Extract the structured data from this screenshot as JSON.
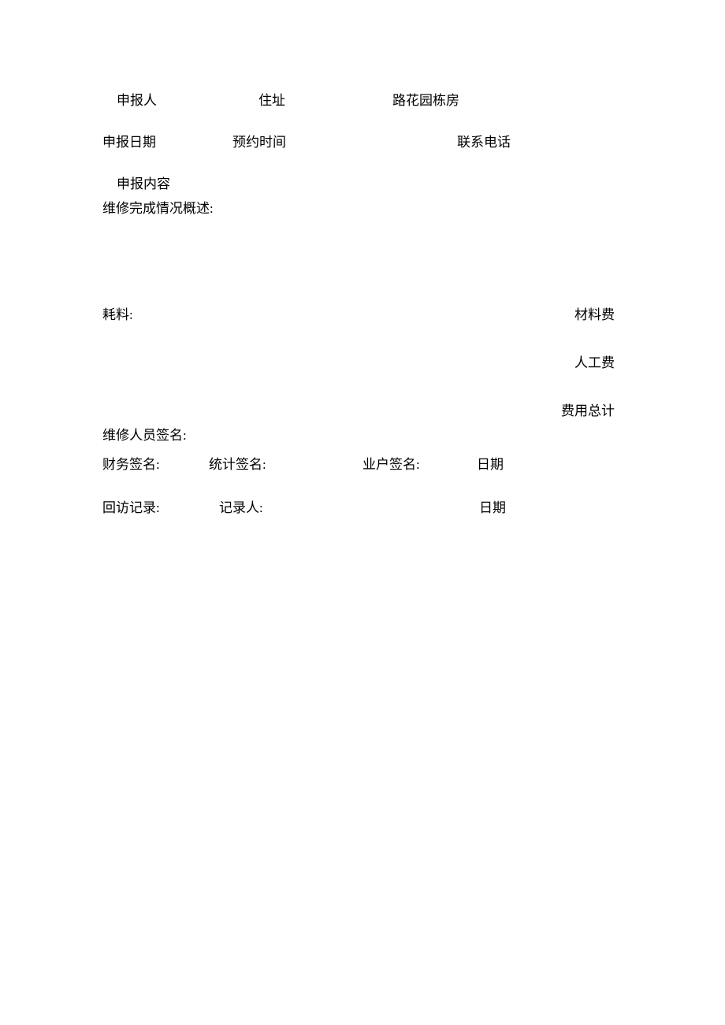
{
  "row1": {
    "applicant_label": "申报人",
    "address_label": "住址",
    "address_value": "路花园栋房"
  },
  "row2": {
    "apply_date_label": "申报日期",
    "appointment_label": "预约时间",
    "phone_label": "联系电话"
  },
  "content": {
    "apply_content_label": "申报内容",
    "repair_summary_label": "维修完成情况概述:"
  },
  "costs": {
    "material_used_label": "耗料:",
    "material_fee_label": "材料费",
    "labor_fee_label": "人工费",
    "total_fee_label": "费用总计"
  },
  "signatures": {
    "repair_staff_label": "维修人员签名:",
    "finance_label": "财务签名:",
    "statistics_label": "统计签名:",
    "owner_label": "业户签名:",
    "date_label": "日期"
  },
  "visit": {
    "record_label": "回访记录:",
    "recorder_label": "记录人:",
    "date_label": "日期"
  }
}
